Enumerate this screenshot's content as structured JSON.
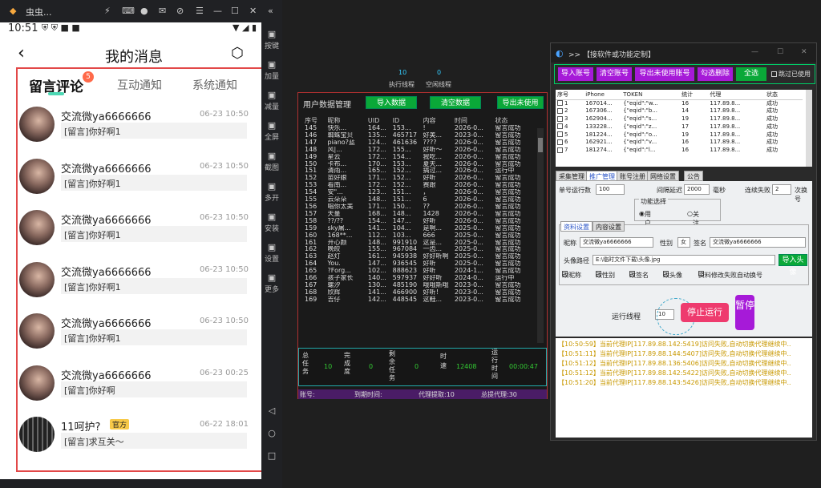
{
  "emulator": {
    "title": "虫虫...",
    "side_buttons": [
      {
        "icon": "keyboard-icon",
        "label": "按键"
      },
      {
        "icon": "volume-up-icon",
        "label": "加量"
      },
      {
        "icon": "volume-down-icon",
        "label": "减量"
      },
      {
        "icon": "fullscreen-icon",
        "label": "全屏"
      },
      {
        "icon": "scissors-icon",
        "label": "截图"
      },
      {
        "icon": "multi-window-icon",
        "label": "多开"
      },
      {
        "icon": "install-icon",
        "label": "安装"
      },
      {
        "icon": "gear-icon",
        "label": "设置"
      },
      {
        "icon": "more-icon",
        "label": "更多"
      }
    ]
  },
  "phone": {
    "time": "10:51",
    "page_title": "我的消息",
    "tabs": [
      "留言评论",
      "互动通知",
      "系统通知"
    ],
    "badge": "5",
    "messages": [
      {
        "name": "交流微ya6666666",
        "time": "06-23 10:50",
        "text": "[留言]你好啊1"
      },
      {
        "name": "交流微ya6666666",
        "time": "06-23 10:50",
        "text": "[留言]你好啊1"
      },
      {
        "name": "交流微ya6666666",
        "time": "06-23 10:50",
        "text": "[留言]你好啊1"
      },
      {
        "name": "交流微ya6666666",
        "time": "06-23 10:50",
        "text": "[留言]你好啊1"
      },
      {
        "name": "交流微ya6666666",
        "time": "06-23 10:50",
        "text": "[留言]你好啊1"
      },
      {
        "name": "交流微ya6666666",
        "time": "06-23 00:25",
        "text": "[留言]你好啊"
      },
      {
        "name": "11呵护?",
        "time": "06-22 18:01",
        "text": "[留言]求互关～",
        "official": "官方"
      }
    ]
  },
  "counters": {
    "exec_threads_value": "10",
    "exec_threads_label": "执行线程",
    "idle_threads_value": "0",
    "idle_threads_label": "空闲线程"
  },
  "user_panel": {
    "title": "用户数据管理",
    "buttons": [
      "导入数据",
      "清空数据",
      "导出未使用"
    ],
    "columns": [
      "序号",
      "昵称",
      "UID",
      "ID",
      "内容",
      "时间",
      "状态"
    ],
    "rows": [
      [
        "145",
        "快乐...",
        "164...",
        "153...",
        "!",
        "2026-0...",
        "留言成功"
      ],
      [
        "146",
        "蜘蛛宝贝",
        "135...",
        "465717",
        "好美...",
        "2023-0...",
        "留言成功"
      ],
      [
        "147",
        "piano?蓝",
        "124...",
        "461636",
        "????",
        "2026-0...",
        "留言成功"
      ],
      [
        "148",
        "风|...",
        "172...",
        "155...",
        "好听～",
        "2026-0...",
        "留言成功"
      ],
      [
        "149",
        "星云",
        "172...",
        "154...",
        "我吃...",
        "2026-0...",
        "留言成功"
      ],
      [
        "150",
        "卡布...",
        "170...",
        "153...",
        "夏天...",
        "2026-0...",
        "留言成功"
      ],
      [
        "151",
        "清雨...",
        "165...",
        "152...",
        "搞过...",
        "2026-0...",
        "运行中"
      ],
      [
        "152",
        "苗好娘",
        "171...",
        "152...",
        "好听",
        "2026-0...",
        "留言成功"
      ],
      [
        "153",
        "看南...",
        "172...",
        "152...",
        "赛跟",
        "2026-0...",
        "留言成功"
      ],
      [
        "154",
        "安\"...",
        "123...",
        "151...",
        "，",
        "2026-0...",
        "留言成功"
      ],
      [
        "155",
        "云朵朵",
        "148...",
        "151...",
        "6",
        "2026-0...",
        "留言成功"
      ],
      [
        "156",
        "唱你太美",
        "171...",
        "150...",
        "??",
        "2026-0...",
        "留言成功"
      ],
      [
        "157",
        "天量",
        "168...",
        "148...",
        "1428",
        "2026-0...",
        "留言成功"
      ],
      [
        "158",
        "??/??",
        "154...",
        "147...",
        "好听",
        "2026-0...",
        "留言成功"
      ],
      [
        "159",
        "sky屠...",
        "141...",
        "104...",
        "是啊...",
        "2025-0...",
        "留言成功"
      ],
      [
        "160",
        "168**...",
        "112...",
        "103...",
        "666",
        "2025-0...",
        "留言成功"
      ],
      [
        "161",
        "开心颜",
        "148...",
        "991910",
        "这是...",
        "2025-0...",
        "留言成功"
      ],
      [
        "162",
        "晚皎",
        "155...",
        "967084",
        "一齿...",
        "2025-0...",
        "留言成功"
      ],
      [
        "163",
        "赵灯",
        "161...",
        "945938",
        "好好听啊",
        "2025-0...",
        "留言成功"
      ],
      [
        "164",
        "You.",
        "147...",
        "936545",
        "好听",
        "2025-0...",
        "留言成功"
      ],
      [
        "165",
        "?Forg...",
        "102...",
        "888623",
        "好听",
        "2024-1...",
        "留言成功"
      ],
      [
        "166",
        "孩子家长",
        "140...",
        "597937",
        "好好听",
        "2024-0...",
        "运行中"
      ],
      [
        "167",
        "螺汐",
        "130...",
        "485190",
        "哦哦斯哦",
        "2023-0...",
        "留言成功"
      ],
      [
        "168",
        "欣辉",
        "141...",
        "466900",
        "好听！",
        "2023-0...",
        "留言成功"
      ],
      [
        "169",
        "吉仔",
        "142...",
        "448545",
        "这鞋...",
        "2023-0...",
        "留言成功"
      ]
    ],
    "stats": {
      "total_label": "总任务",
      "total": "10",
      "done_label": "完成度",
      "done": "0",
      "remain_label": "剩余任务",
      "remain": "0",
      "speed_label": "时速",
      "speed": "12408",
      "runtime_label": "运行时间",
      "runtime": "00:00:47"
    },
    "status_bar": {
      "account": "账号:",
      "expiry": "到期时间:",
      "proxy_fetch": "代理提取:10",
      "proxy_total": "总提代理:30"
    }
  },
  "tool_panel": {
    "title": ">> 【接软件或功能定制】",
    "buttons": [
      "导入账号",
      "清空账号",
      "导出未使用账号",
      "勾选删除",
      "全选"
    ],
    "skip_used": "跳过已使用",
    "columns": [
      "序号",
      "iPhone",
      "TOKEN",
      "统计",
      "代理",
      "状态"
    ],
    "rows": [
      [
        "1",
        "167014...",
        "{\"eqid\":\"w...",
        "16",
        "117.89.8...",
        "成功"
      ],
      [
        "2",
        "167306...",
        "{\"eqid\":\"b...",
        "14",
        "117.89.8...",
        "成功"
      ],
      [
        "3",
        "162904...",
        "{\"eqid\":\"s...",
        "19",
        "117.89.8...",
        "成功"
      ],
      [
        "4",
        "133228...",
        "{\"eqid\":\"z...",
        "17",
        "117.89.8...",
        "成功"
      ],
      [
        "5",
        "181224...",
        "{\"eqid\":\"o...",
        "19",
        "117.89.8...",
        "成功"
      ],
      [
        "6",
        "162921...",
        "{\"eqid\":\"v...",
        "16",
        "117.89.8...",
        "成功"
      ],
      [
        "7",
        "181274...",
        "{\"eqid\":\"l...",
        "16",
        "117.89.8...",
        "成功"
      ]
    ],
    "tabs": [
      "采集管理",
      "推广管理",
      "账号注册",
      "网络设置",
      "公告"
    ],
    "single_runs_label": "单号运行数",
    "single_runs": "100",
    "interval_label": "间隔延迟",
    "interval": "2000",
    "interval_unit": "毫秒",
    "fail_label": "连续失败",
    "fail": "2",
    "fail_unit": "次换号",
    "func_label": "功能选择",
    "opt_comment": "用户留言",
    "opt_follow": "关注",
    "subtabs": [
      "资料设置",
      "内容设置"
    ],
    "nick_label": "昵称",
    "nick": "交流微ya6666666",
    "gender_label": "性别",
    "gender": "女",
    "sign_label": "签名",
    "sign": "交流微ya6666666",
    "avatar_label": "头像路径",
    "avatar_path": "E:\\临时文件下载\\头像.jpg",
    "import_avatar": "导入头像",
    "checks": [
      "改昵称",
      "改性别",
      "改签名",
      "改头像",
      "资料修改失败自动换号"
    ],
    "run_threads_label": "运行线程",
    "run_threads": "10",
    "stop_button": "停止运行",
    "pause_button": "暂停",
    "logs": [
      "【10:50:59】当前代理IP[117.89.88.142:5419]访问失败,自动切换代理继续中..",
      "【10:51:11】当前代理IP[117.89.88.144:5407]访问失败,自动切换代理继续中..",
      "【10:51:12】当前代理IP[117.89.88.136:5406]访问失败,自动切换代理继续中..",
      "【10:51:12】当前代理IP[117.89.88.142:5422]访问失败,自动切换代理继续中..",
      "【10:51:20】当前代理IP[117.89.88.143:5426]访问失败,自动切换代理继续中.."
    ],
    "colors": {
      "purple": "#a61ad8",
      "green": "#0aa838",
      "log": "#c89800"
    }
  }
}
